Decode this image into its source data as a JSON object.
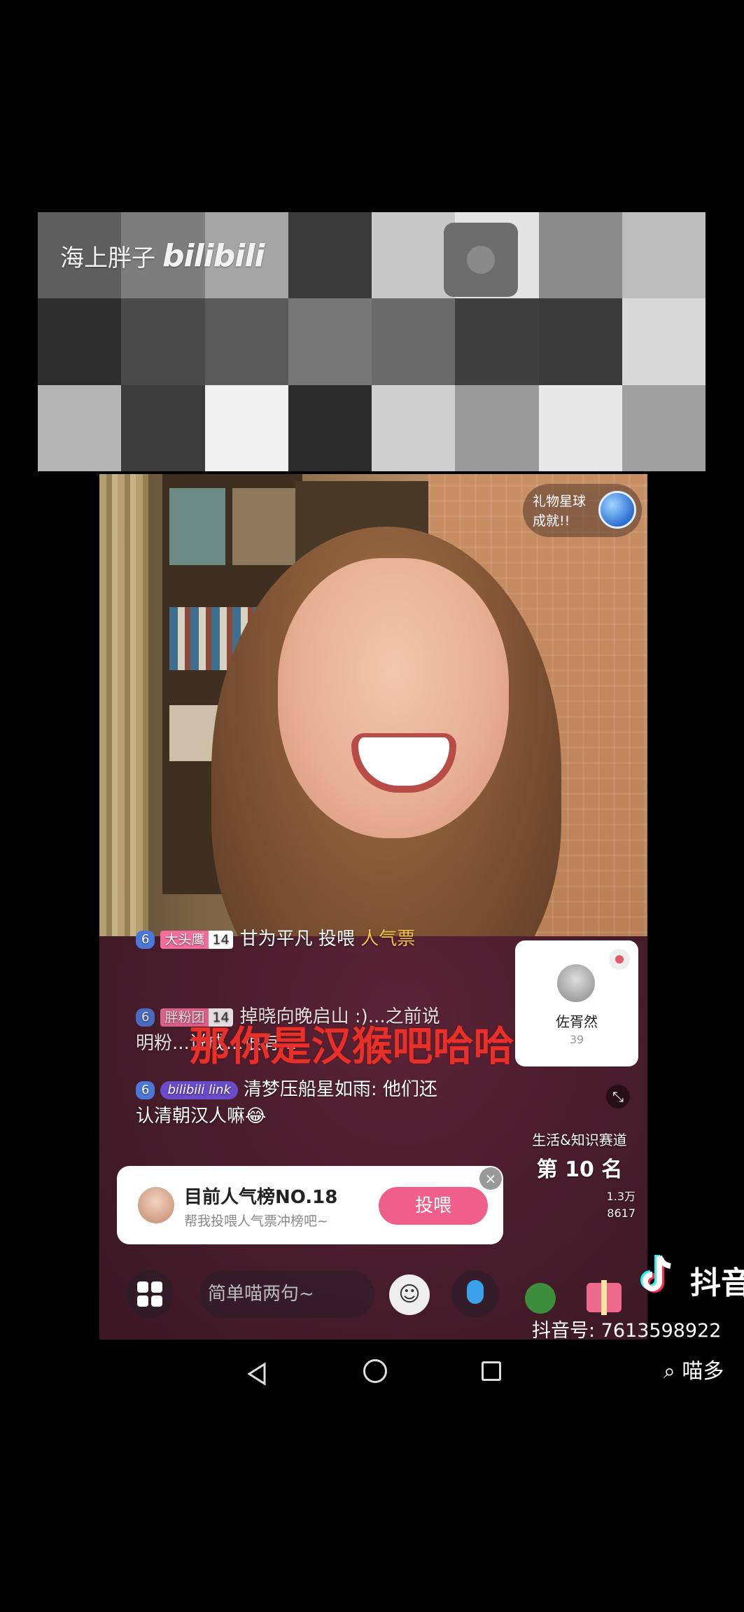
{
  "watermark": {
    "uploader": "海上胖子",
    "site": "bilibili"
  },
  "mosaic_colors": [
    "#5e5e5e",
    "#7d7d7d",
    "#a5a5a5",
    "#3a3a3a",
    "#c8c8c8",
    "#e4e4e4",
    "#8c8c8c",
    "#bdbdbd",
    "#2e2e2e",
    "#4a4a4a",
    "#5a5a5a",
    "#777777",
    "#6a6a6a",
    "#3f3f3f",
    "#3b3b3b",
    "#d8d8d8",
    "#b5b5b5",
    "#3c3c3c",
    "#f0f0f0",
    "#2c2c2c",
    "#cfcfcf",
    "#9a9a9a",
    "#e8e8e8",
    "#a0a0a0"
  ],
  "live": {
    "gift_planet": {
      "line1": "礼物星球",
      "line2": "成就!!"
    },
    "comments": [
      {
        "level": "6",
        "fan_badge": "大头鹰",
        "fan_level": "14",
        "text": "甘为平凡  投喂 ",
        "highlight": "人气票"
      },
      {
        "level": "6",
        "fan_badge": "胖粉团",
        "fan_level": "14",
        "text": "掉晓向晚启山 :)...之前说",
        "text2": "明粉...说成...很有..."
      },
      {
        "level": "6",
        "badge": "bilibili link",
        "text": "清梦压船星如雨: 他们还",
        "text2": "认清朝汉人嘛😂"
      }
    ],
    "subtitle": "那你是汉猴吧哈哈哈",
    "user_card": {
      "name": "佐胥然",
      "count": "39"
    },
    "ranking": {
      "category": "生活&知识赛道",
      "prefix": "第",
      "number": "10",
      "suffix": "名",
      "stat1": "1.3万",
      "stat2": "8617"
    },
    "prompt": {
      "title": "目前人气榜NO.18",
      "subtitle": "帮我投喂人气票冲榜吧~",
      "button": "投喂"
    },
    "input_placeholder": "简单喵两句~"
  },
  "douyin": {
    "brand": "抖音",
    "id_label": "抖音号: 7613598922",
    "search": "喵多"
  },
  "colors": {
    "accent_pink": "#f05f8a",
    "subtitle_red": "#e8302b",
    "level_blue": "#4b78d8"
  }
}
